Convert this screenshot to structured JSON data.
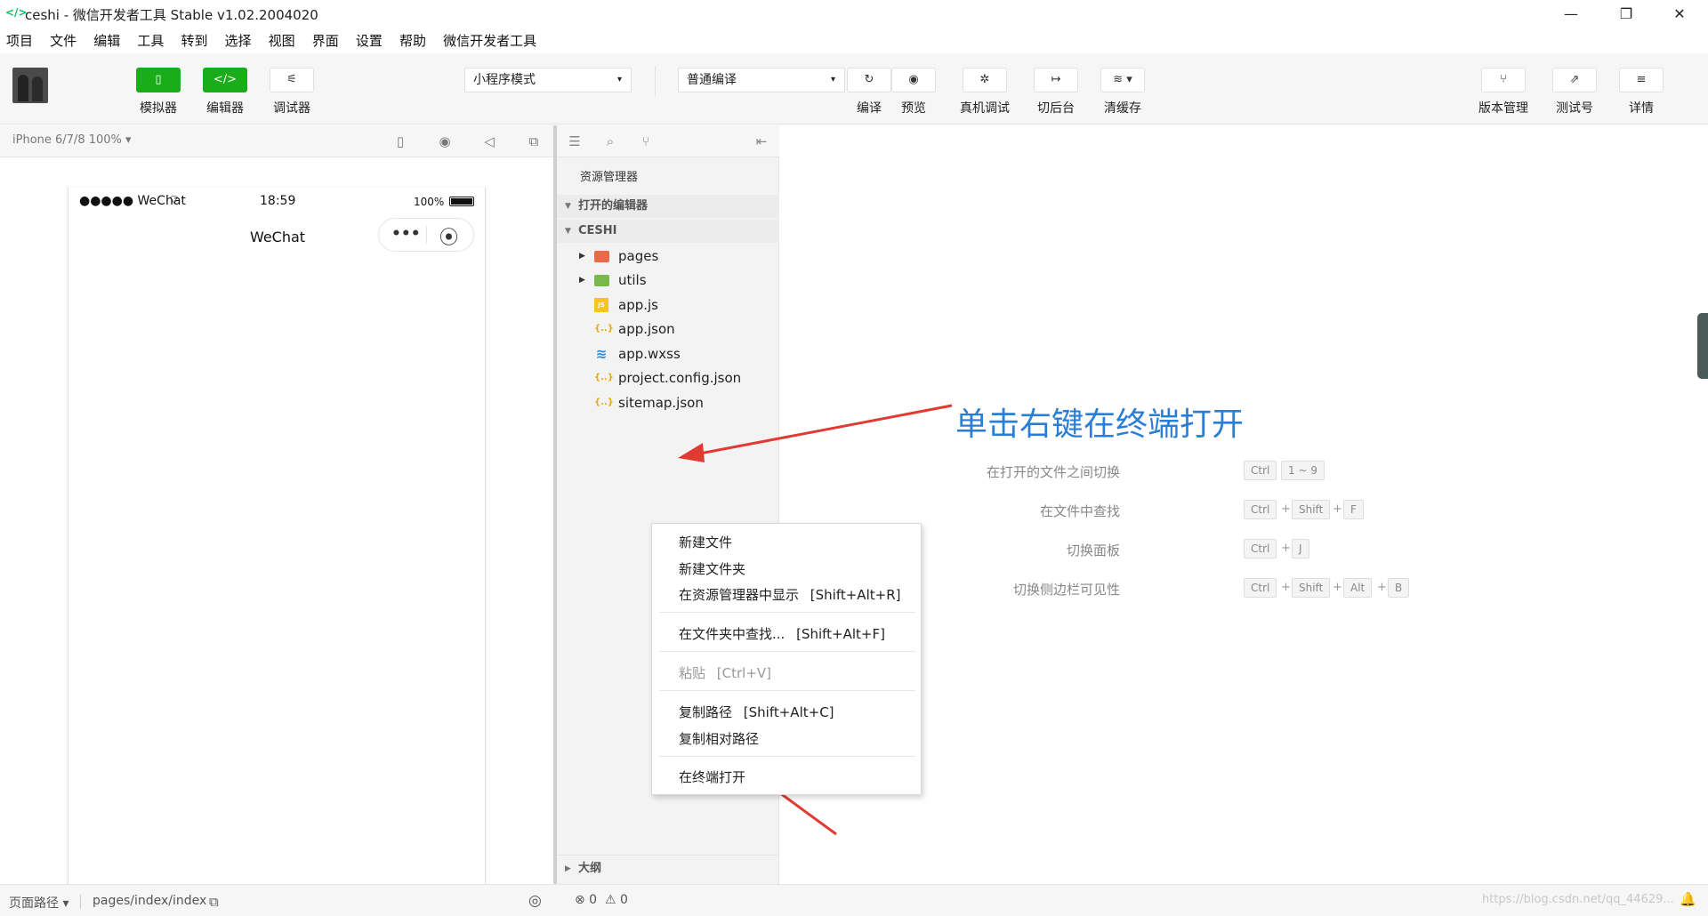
{
  "window": {
    "title": "ceshi - 微信开发者工具 Stable v1.02.2004020",
    "logo": "</>",
    "controls": {
      "minimize": "—",
      "maximize": "❐",
      "close": "✕"
    }
  },
  "menubar": [
    "项目",
    "文件",
    "编辑",
    "工具",
    "转到",
    "选择",
    "视图",
    "界面",
    "设置",
    "帮助",
    "微信开发者工具"
  ],
  "toolbar": {
    "simulator": {
      "label": "模拟器",
      "icon": "phone-icon",
      "glyph": "▯"
    },
    "editor": {
      "label": "编辑器",
      "icon": "code-icon",
      "glyph": "</>"
    },
    "debugger": {
      "label": "调试器",
      "icon": "debug-icon",
      "glyph": "⚟"
    },
    "mode_select": "小程序模式",
    "compile_select": "普通编译",
    "compile": {
      "label": "编译",
      "glyph": "↻"
    },
    "preview": {
      "label": "预览",
      "glyph": "◉"
    },
    "remote_debug": {
      "label": "真机调试",
      "glyph": "✲"
    },
    "background": {
      "label": "切后台",
      "glyph": "↦"
    },
    "clear_cache": {
      "label": "清缓存",
      "glyph": "≋ ▾"
    },
    "version": {
      "label": "版本管理",
      "glyph": "⑂"
    },
    "test": {
      "label": "测试号",
      "glyph": "⇗"
    },
    "details": {
      "label": "详情",
      "glyph": "≡"
    },
    "caret": "▾"
  },
  "simulator": {
    "device": "iPhone 6/7/8 100% ▾",
    "status_signal": "●●●●● WeChat",
    "wifi": "⌔",
    "time": "18:59",
    "battery": "100%",
    "page_title": "WeChat",
    "capsule_more": "•••",
    "capsule_close": "⦿",
    "footer_path_label": "页面路径 ▾",
    "footer_path": "pages/index/index",
    "copy_icon": "⧉",
    "eye_icon": "◎"
  },
  "explorer": {
    "title": "资源管理器",
    "open_editors": "打开的编辑器",
    "project": "CESHI",
    "folders": [
      {
        "name": "pages",
        "color": "#e96a47"
      },
      {
        "name": "utils",
        "color": "#79b84a"
      }
    ],
    "files": [
      {
        "name": "app.js",
        "glyph": "JS",
        "color": "#f5c518"
      },
      {
        "name": "app.json",
        "glyph": "{..}",
        "color": "#e6a817"
      },
      {
        "name": "app.wxss",
        "glyph": "≋",
        "color": "#2a8ad4"
      },
      {
        "name": "project.config.json",
        "glyph": "{..}",
        "color": "#e6a817"
      },
      {
        "name": "sitemap.json",
        "glyph": "{..}",
        "color": "#e6a817"
      }
    ],
    "outline": "大纲",
    "arrow_down": "▼",
    "arrow_right": "▶",
    "status_errors": "⊗ 0",
    "status_warnings": "⚠ 0"
  },
  "editor": {
    "annotation": "单击右键在终端打开",
    "shortcuts": [
      {
        "label": "在打开的文件之间切换",
        "keys": [
          "Ctrl",
          "1 ~ 9"
        ]
      },
      {
        "label": "在文件中查找",
        "keys": [
          "Ctrl",
          "Shift",
          "F"
        ]
      },
      {
        "label": "切换面板",
        "keys": [
          "Ctrl",
          "J"
        ]
      },
      {
        "label": "切换侧边栏可见性",
        "keys": [
          "Ctrl",
          "Shift",
          "Alt",
          "B"
        ]
      }
    ],
    "plus": "+",
    "watermark": "https://blog.csdn.net/qq_44629...",
    "bell": "🔔"
  },
  "context_menu": {
    "new_file": "新建文件",
    "new_folder": "新建文件夹",
    "reveal": "在资源管理器中显示",
    "reveal_shortcut": "[Shift+Alt+R]",
    "find_in_folder": "在文件夹中查找...",
    "find_shortcut": "[Shift+Alt+F]",
    "paste": "粘贴",
    "paste_shortcut": "[Ctrl+V]",
    "copy_path": "复制路径",
    "copy_path_shortcut": "[Shift+Alt+C]",
    "copy_relative_path": "复制相对路径",
    "open_in_terminal": "在终端打开"
  },
  "colors": {
    "accent_green": "#1aad19",
    "annotation_blue": "#2a7fd4",
    "arrow_red": "#e03a32"
  }
}
